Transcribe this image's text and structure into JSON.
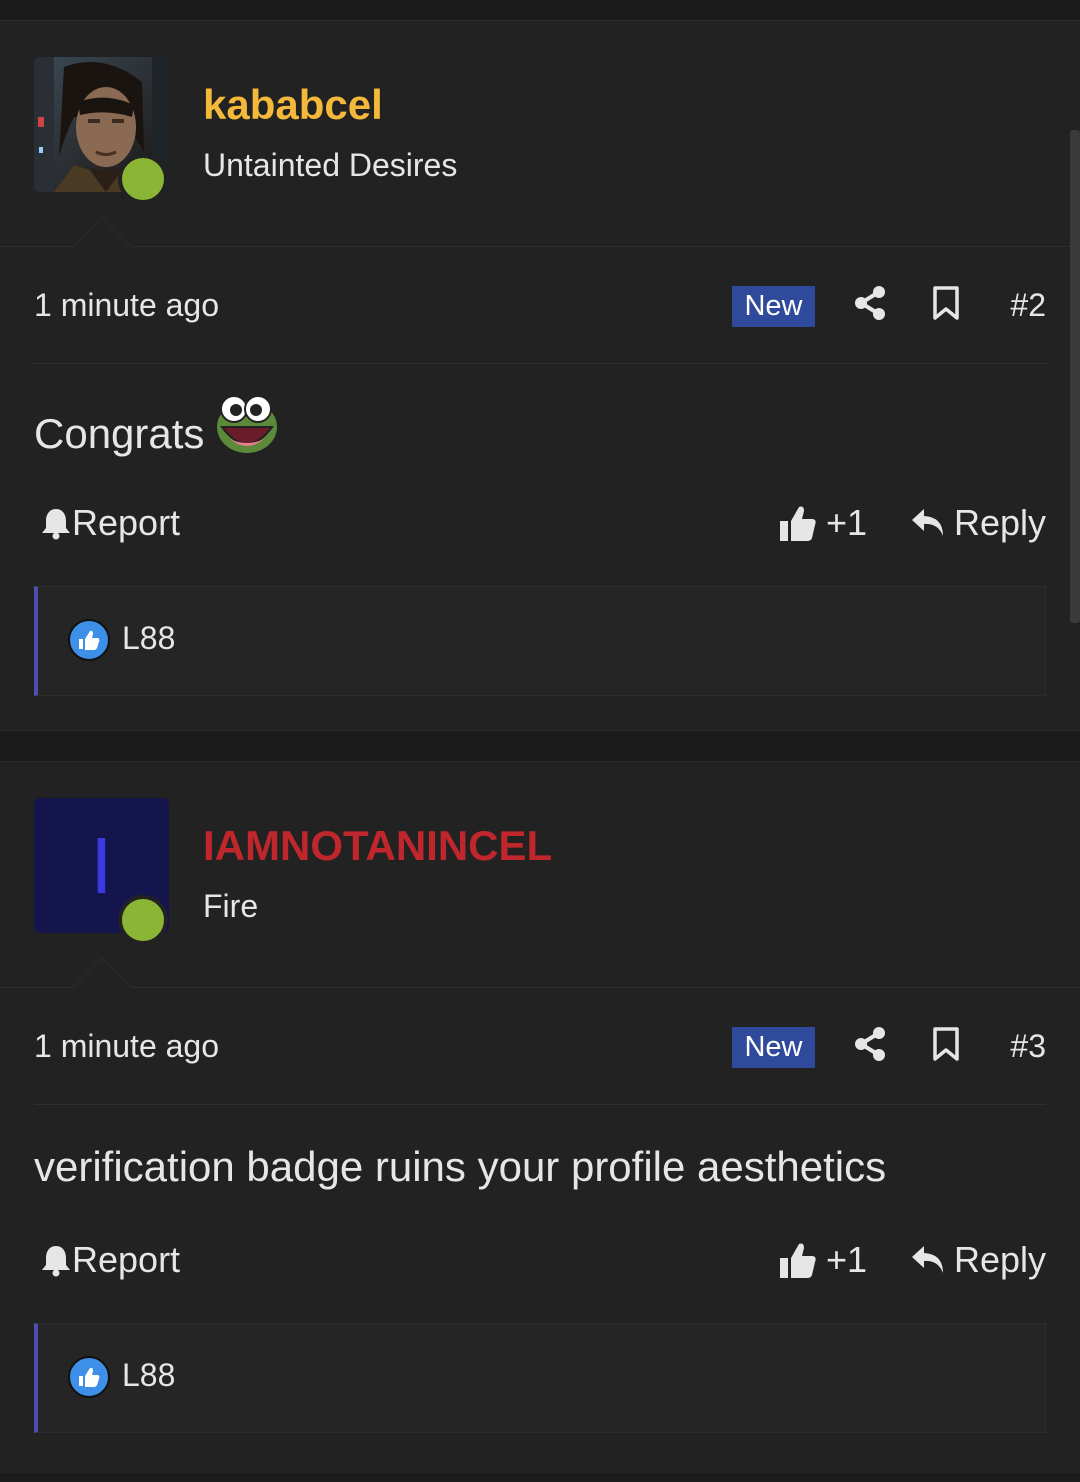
{
  "colors": {
    "username_gold": "#f4b93a",
    "username_red": "#c0272d",
    "online": "#8ab535",
    "new_badge_bg": "#2f4a9a",
    "reaction_bar": "#4d4fb0"
  },
  "posts": [
    {
      "username": "kababcel",
      "username_color": "#f4b93a",
      "user_title": "Untainted Desires",
      "avatar_type": "photo",
      "avatar_letter": "",
      "time": "1 minute ago",
      "badge": "New",
      "post_number": "#2",
      "content": "Congrats",
      "content_emoji": "frog-emoji-icon",
      "report_label": "Report",
      "like_label": "+1",
      "reply_label": "Reply",
      "reaction_user": "L88"
    },
    {
      "username": "IAMNOTANINCEL",
      "username_color": "#c0272d",
      "user_title": "Fire",
      "avatar_type": "letter",
      "avatar_letter": "I",
      "time": "1 minute ago",
      "badge": "New",
      "post_number": "#3",
      "content": "verification badge ruins your profile aesthetics",
      "content_emoji": "",
      "report_label": "Report",
      "like_label": "+1",
      "reply_label": "Reply",
      "reaction_user": "L88"
    }
  ]
}
